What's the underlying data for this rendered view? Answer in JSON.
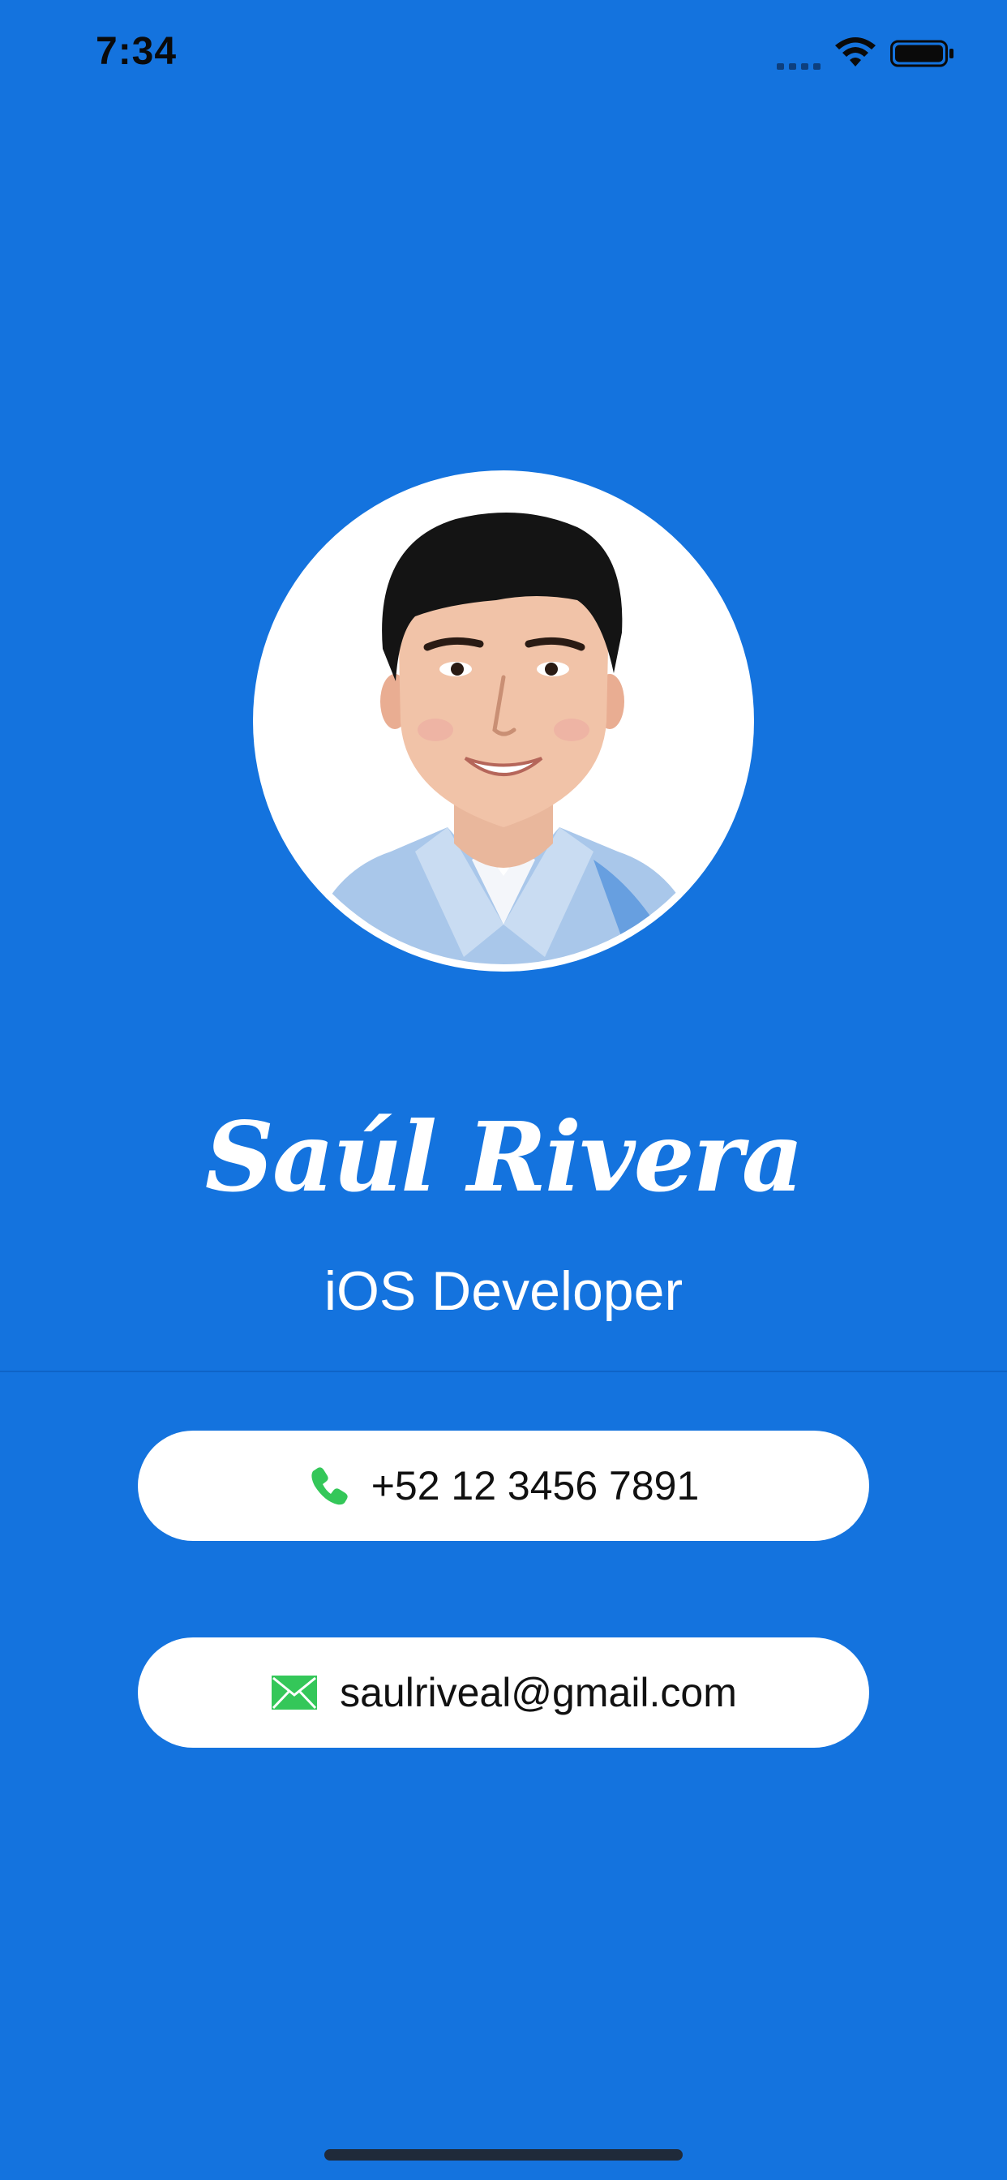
{
  "status_bar": {
    "time": "7:34",
    "signal_icon": "cellular-signal-icon",
    "wifi_icon": "wifi-icon",
    "battery_icon": "battery-icon"
  },
  "profile": {
    "avatar_icon": "profile-photo",
    "name": "Saúl Rivera",
    "title": "iOS Developer"
  },
  "contacts": {
    "phone": {
      "icon": "phone-icon",
      "value": "+52 12 3456 7891"
    },
    "email": {
      "icon": "envelope-icon",
      "value": "saulriveal@gmail.com"
    }
  },
  "colors": {
    "background": "#1473DE",
    "pill_background": "#FFFFFF",
    "icon_green": "#34C759",
    "text_dark": "#111111",
    "text_light": "#FFFFFF"
  }
}
